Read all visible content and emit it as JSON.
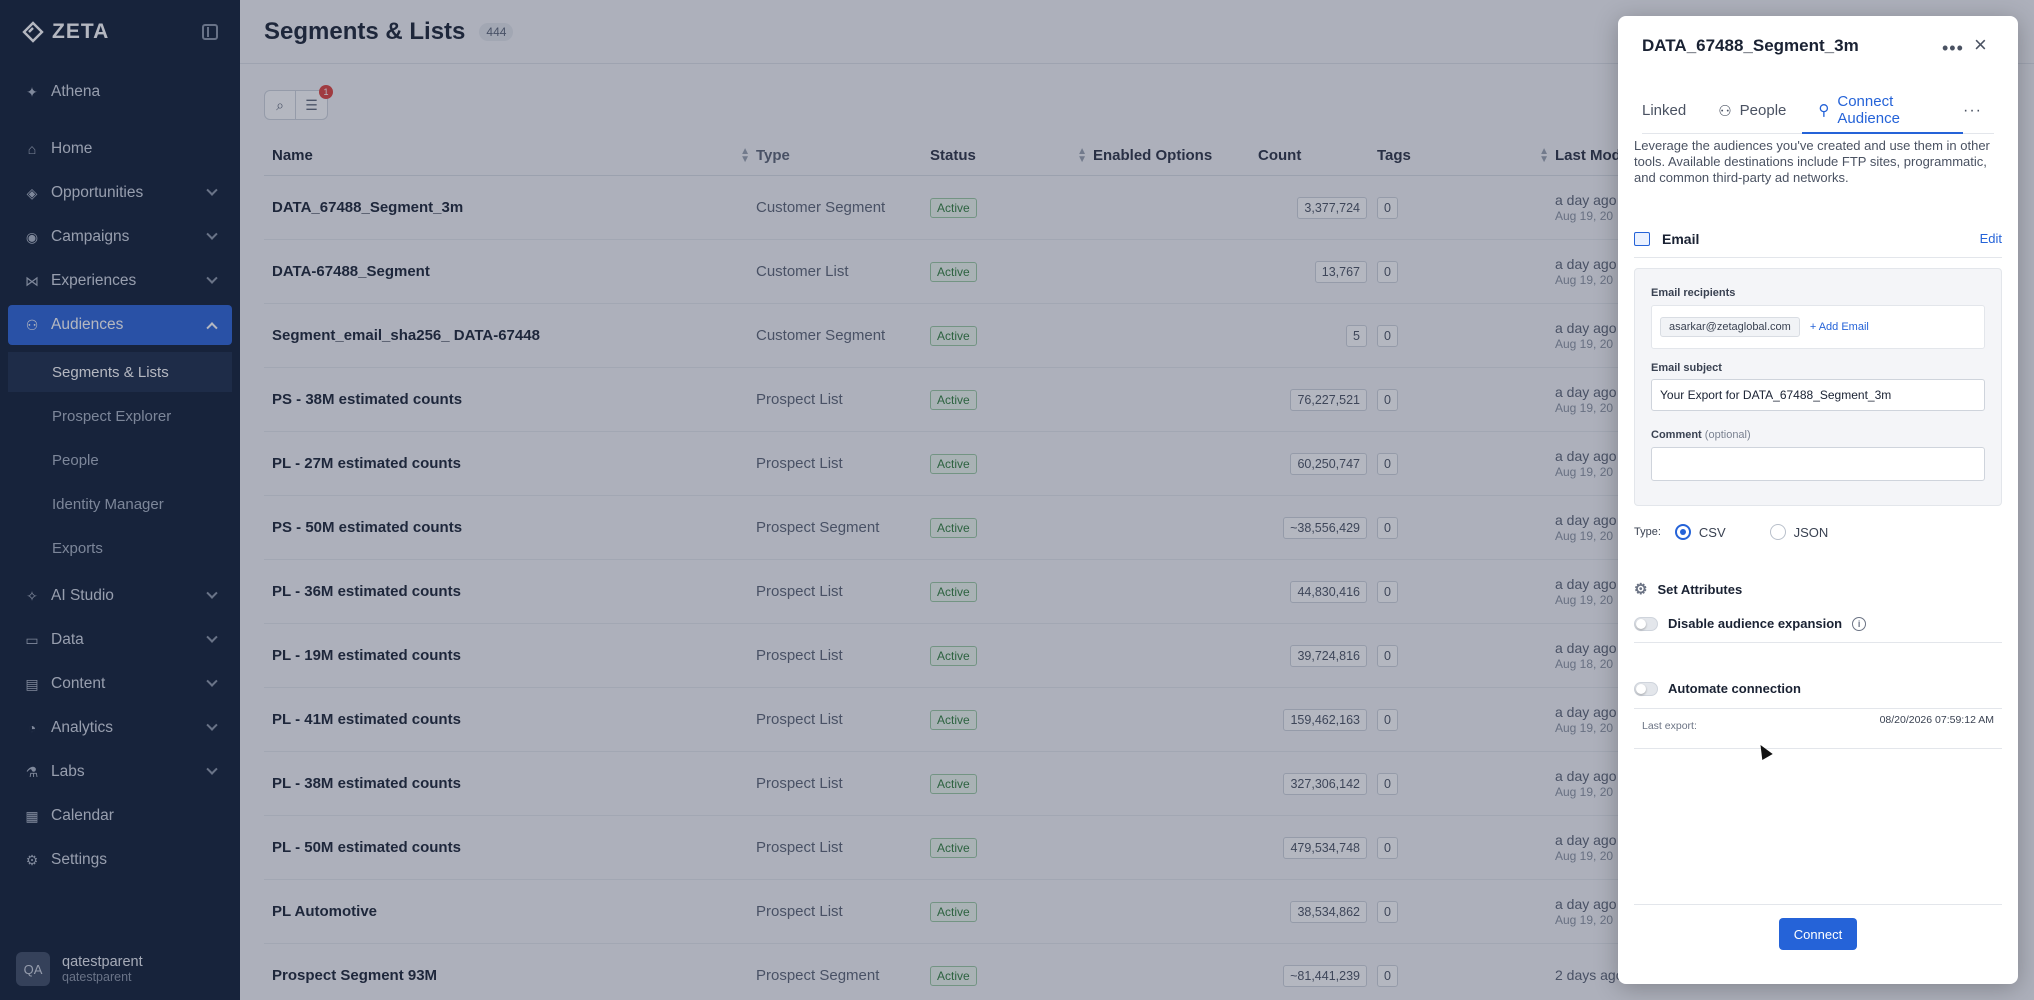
{
  "sidebar": {
    "logo": "ZETA",
    "athena": "Athena",
    "items": [
      {
        "label": "Home",
        "icon": "home-icon"
      },
      {
        "label": "Opportunities",
        "icon": "opportunities-icon"
      },
      {
        "label": "Campaigns",
        "icon": "campaigns-icon"
      },
      {
        "label": "Experiences",
        "icon": "experiences-icon"
      },
      {
        "label": "Audiences",
        "icon": "audiences-icon"
      },
      {
        "label": "AI Studio",
        "icon": "ai-studio-icon"
      },
      {
        "label": "Data",
        "icon": "data-icon"
      },
      {
        "label": "Content",
        "icon": "content-icon"
      },
      {
        "label": "Analytics",
        "icon": "analytics-icon"
      },
      {
        "label": "Labs",
        "icon": "labs-icon"
      },
      {
        "label": "Calendar",
        "icon": "calendar-icon"
      },
      {
        "label": "Settings",
        "icon": "settings-icon"
      }
    ],
    "subitems": [
      "Segments & Lists",
      "Prospect Explorer",
      "People",
      "Identity Manager",
      "Exports"
    ],
    "user": {
      "initials": "QA",
      "name": "qatestparent",
      "sub": "qatestparent"
    }
  },
  "main": {
    "title": "Segments & Lists",
    "count": "444",
    "filter_count": "1",
    "columns": [
      "Name",
      "Type",
      "Status",
      "Enabled Options",
      "Count",
      "Tags",
      "Last Mod"
    ],
    "rows": [
      {
        "name": "DATA_67488_Segment_3m",
        "type": "Customer Segment",
        "status": "Active",
        "count": "3,377,724",
        "tags": "0",
        "mod": "a day ago",
        "mod_sub": "Aug 19, 20"
      },
      {
        "name": "DATA-67488_Segment",
        "type": "Customer List",
        "status": "Active",
        "count": "13,767",
        "tags": "0",
        "mod": "a day ago",
        "mod_sub": "Aug 19, 20"
      },
      {
        "name": "Segment_email_sha256_ DATA-67448",
        "type": "Customer Segment",
        "status": "Active",
        "count": "5",
        "tags": "0",
        "mod": "a day ago",
        "mod_sub": "Aug 19, 20"
      },
      {
        "name": "PS - 38M estimated counts",
        "type": "Prospect List",
        "status": "Active",
        "count": "76,227,521",
        "tags": "0",
        "mod": "a day ago",
        "mod_sub": "Aug 19, 20"
      },
      {
        "name": "PL - 27M estimated counts",
        "type": "Prospect List",
        "status": "Active",
        "count": "60,250,747",
        "tags": "0",
        "mod": "a day ago",
        "mod_sub": "Aug 19, 20"
      },
      {
        "name": "PS - 50M estimated counts",
        "type": "Prospect Segment",
        "status": "Active",
        "count": "~38,556,429",
        "tags": "0",
        "mod": "a day ago",
        "mod_sub": "Aug 19, 20"
      },
      {
        "name": "PL - 36M estimated counts",
        "type": "Prospect List",
        "status": "Active",
        "count": "44,830,416",
        "tags": "0",
        "mod": "a day ago",
        "mod_sub": "Aug 19, 20"
      },
      {
        "name": "PL - 19M estimated counts",
        "type": "Prospect List",
        "status": "Active",
        "count": "39,724,816",
        "tags": "0",
        "mod": "a day ago",
        "mod_sub": "Aug 18, 20"
      },
      {
        "name": "PL - 41M estimated counts",
        "type": "Prospect List",
        "status": "Active",
        "count": "159,462,163",
        "tags": "0",
        "mod": "a day ago",
        "mod_sub": "Aug 19, 20"
      },
      {
        "name": "PL - 38M estimated counts",
        "type": "Prospect List",
        "status": "Active",
        "count": "327,306,142",
        "tags": "0",
        "mod": "a day ago",
        "mod_sub": "Aug 19, 20"
      },
      {
        "name": "PL - 50M estimated counts",
        "type": "Prospect List",
        "status": "Active",
        "count": "479,534,748",
        "tags": "0",
        "mod": "a day ago",
        "mod_sub": "Aug 19, 20"
      },
      {
        "name": "PL Automotive",
        "type": "Prospect List",
        "status": "Active",
        "count": "38,534,862",
        "tags": "0",
        "mod": "a day ago",
        "mod_sub": "Aug 19, 20"
      },
      {
        "name": "Prospect Segment 93M",
        "type": "Prospect Segment",
        "status": "Active",
        "count": "~81,441,239",
        "tags": "0",
        "mod": "2 days ago",
        "mod_sub": ""
      }
    ]
  },
  "drawer": {
    "title": "DATA_67488_Segment_3m",
    "tabs": [
      "Linked",
      "People",
      "Connect Audience"
    ],
    "description": "Leverage the audiences you've created and use them in other tools. Available destinations include FTP sites, programmatic, and common third-party ad networks.",
    "email_label": "Email",
    "edit_label": "Edit",
    "recipients_label": "Email recipients",
    "recipient": "asarkar@zetaglobal.com",
    "add_email": "Add Email",
    "subject_label": "Email subject",
    "subject_value": "Your Export for DATA_67488_Segment_3m",
    "comment_label": "Comment",
    "comment_optional": "(optional)",
    "type_label": "Type:",
    "type_options": [
      "CSV",
      "JSON"
    ],
    "type_selected": "CSV",
    "set_attributes": "Set Attributes",
    "disable_expansion": "Disable audience expansion",
    "automate": "Automate connection",
    "last_export_label": "Last export:",
    "last_export_value": "08/20/2026 07:59:12 AM",
    "connect_label": "Connect"
  },
  "colors": {
    "accent": "#2563d8",
    "sidebar_bg": "#0f1c33",
    "active_nav": "#2a63d8"
  }
}
